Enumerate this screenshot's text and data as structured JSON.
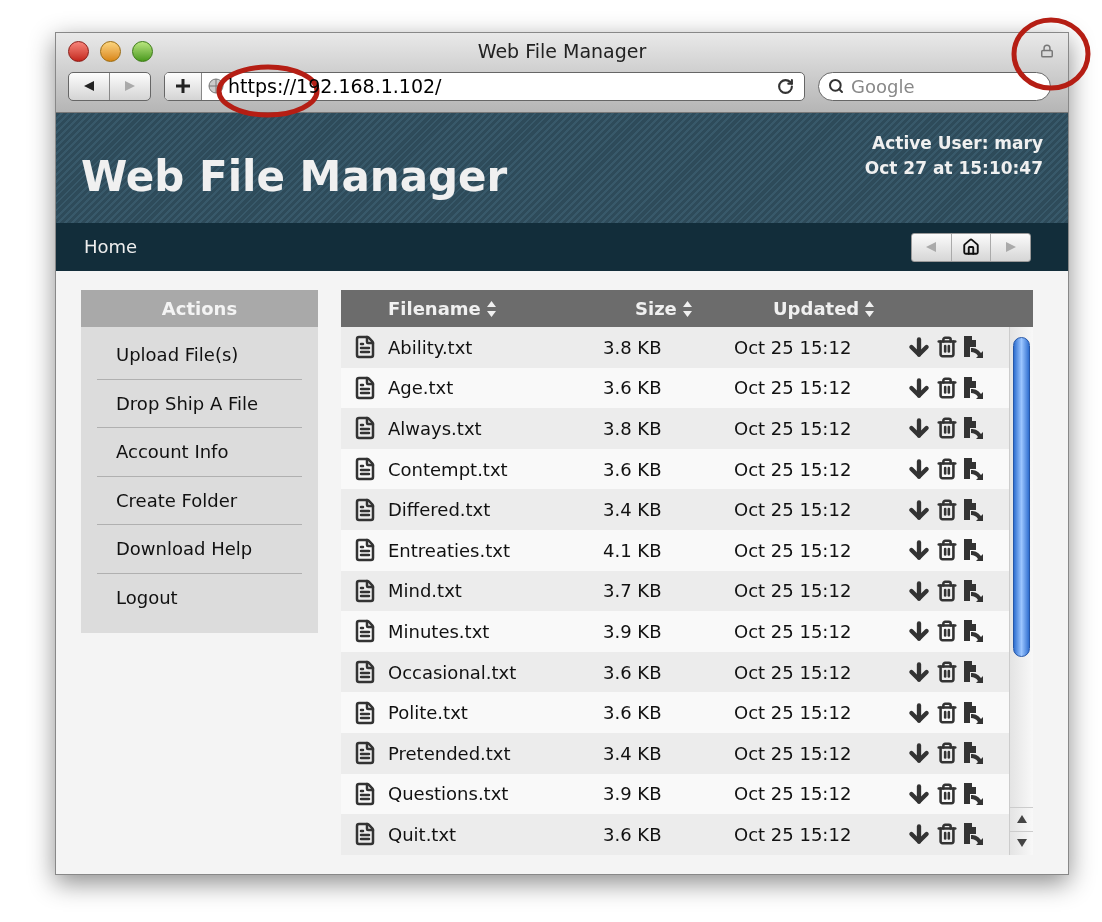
{
  "window": {
    "title": "Web File Manager"
  },
  "toolbar": {
    "url": "https://192.168.1.102/",
    "search_placeholder": "Google"
  },
  "header": {
    "title": "Web File Manager",
    "active_user": "Active User: mary",
    "datetime": "Oct 27 at 15:10:47"
  },
  "nav": {
    "items": [
      "Home"
    ]
  },
  "sidebar": {
    "title": "Actions",
    "items": [
      "Upload File(s)",
      "Drop Ship A File",
      "Account Info",
      "Create Folder",
      "Download Help",
      "Logout"
    ]
  },
  "table": {
    "columns": [
      "Filename",
      "Size",
      "Updated"
    ],
    "rows": [
      {
        "filename": "Ability.txt",
        "size": "3.8 KB",
        "updated": "Oct 25 15:12"
      },
      {
        "filename": "Age.txt",
        "size": "3.6 KB",
        "updated": "Oct 25 15:12"
      },
      {
        "filename": "Always.txt",
        "size": "3.8 KB",
        "updated": "Oct 25 15:12"
      },
      {
        "filename": "Contempt.txt",
        "size": "3.6 KB",
        "updated": "Oct 25 15:12"
      },
      {
        "filename": "Differed.txt",
        "size": "3.4 KB",
        "updated": "Oct 25 15:12"
      },
      {
        "filename": "Entreaties.txt",
        "size": "4.1 KB",
        "updated": "Oct 25 15:12"
      },
      {
        "filename": "Mind.txt",
        "size": "3.7 KB",
        "updated": "Oct 25 15:12"
      },
      {
        "filename": "Minutes.txt",
        "size": "3.9 KB",
        "updated": "Oct 25 15:12"
      },
      {
        "filename": "Occasional.txt",
        "size": "3.6 KB",
        "updated": "Oct 25 15:12"
      },
      {
        "filename": "Polite.txt",
        "size": "3.6 KB",
        "updated": "Oct 25 15:12"
      },
      {
        "filename": "Pretended.txt",
        "size": "3.4 KB",
        "updated": "Oct 25 15:12"
      },
      {
        "filename": "Questions.txt",
        "size": "3.9 KB",
        "updated": "Oct 25 15:12"
      },
      {
        "filename": "Quit.txt",
        "size": "3.6 KB",
        "updated": "Oct 25 15:12"
      }
    ]
  }
}
